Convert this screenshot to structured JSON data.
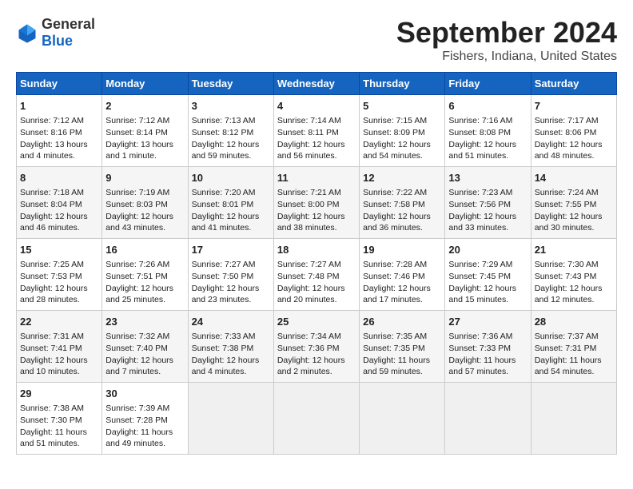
{
  "header": {
    "logo_general": "General",
    "logo_blue": "Blue",
    "month_year": "September 2024",
    "location": "Fishers, Indiana, United States"
  },
  "days_of_week": [
    "Sunday",
    "Monday",
    "Tuesday",
    "Wednesday",
    "Thursday",
    "Friday",
    "Saturday"
  ],
  "weeks": [
    [
      {
        "day": 1,
        "lines": [
          "Sunrise: 7:12 AM",
          "Sunset: 8:16 PM",
          "Daylight: 13 hours",
          "and 4 minutes."
        ]
      },
      {
        "day": 2,
        "lines": [
          "Sunrise: 7:12 AM",
          "Sunset: 8:14 PM",
          "Daylight: 13 hours",
          "and 1 minute."
        ]
      },
      {
        "day": 3,
        "lines": [
          "Sunrise: 7:13 AM",
          "Sunset: 8:12 PM",
          "Daylight: 12 hours",
          "and 59 minutes."
        ]
      },
      {
        "day": 4,
        "lines": [
          "Sunrise: 7:14 AM",
          "Sunset: 8:11 PM",
          "Daylight: 12 hours",
          "and 56 minutes."
        ]
      },
      {
        "day": 5,
        "lines": [
          "Sunrise: 7:15 AM",
          "Sunset: 8:09 PM",
          "Daylight: 12 hours",
          "and 54 minutes."
        ]
      },
      {
        "day": 6,
        "lines": [
          "Sunrise: 7:16 AM",
          "Sunset: 8:08 PM",
          "Daylight: 12 hours",
          "and 51 minutes."
        ]
      },
      {
        "day": 7,
        "lines": [
          "Sunrise: 7:17 AM",
          "Sunset: 8:06 PM",
          "Daylight: 12 hours",
          "and 48 minutes."
        ]
      }
    ],
    [
      {
        "day": 8,
        "lines": [
          "Sunrise: 7:18 AM",
          "Sunset: 8:04 PM",
          "Daylight: 12 hours",
          "and 46 minutes."
        ]
      },
      {
        "day": 9,
        "lines": [
          "Sunrise: 7:19 AM",
          "Sunset: 8:03 PM",
          "Daylight: 12 hours",
          "and 43 minutes."
        ]
      },
      {
        "day": 10,
        "lines": [
          "Sunrise: 7:20 AM",
          "Sunset: 8:01 PM",
          "Daylight: 12 hours",
          "and 41 minutes."
        ]
      },
      {
        "day": 11,
        "lines": [
          "Sunrise: 7:21 AM",
          "Sunset: 8:00 PM",
          "Daylight: 12 hours",
          "and 38 minutes."
        ]
      },
      {
        "day": 12,
        "lines": [
          "Sunrise: 7:22 AM",
          "Sunset: 7:58 PM",
          "Daylight: 12 hours",
          "and 36 minutes."
        ]
      },
      {
        "day": 13,
        "lines": [
          "Sunrise: 7:23 AM",
          "Sunset: 7:56 PM",
          "Daylight: 12 hours",
          "and 33 minutes."
        ]
      },
      {
        "day": 14,
        "lines": [
          "Sunrise: 7:24 AM",
          "Sunset: 7:55 PM",
          "Daylight: 12 hours",
          "and 30 minutes."
        ]
      }
    ],
    [
      {
        "day": 15,
        "lines": [
          "Sunrise: 7:25 AM",
          "Sunset: 7:53 PM",
          "Daylight: 12 hours",
          "and 28 minutes."
        ]
      },
      {
        "day": 16,
        "lines": [
          "Sunrise: 7:26 AM",
          "Sunset: 7:51 PM",
          "Daylight: 12 hours",
          "and 25 minutes."
        ]
      },
      {
        "day": 17,
        "lines": [
          "Sunrise: 7:27 AM",
          "Sunset: 7:50 PM",
          "Daylight: 12 hours",
          "and 23 minutes."
        ]
      },
      {
        "day": 18,
        "lines": [
          "Sunrise: 7:27 AM",
          "Sunset: 7:48 PM",
          "Daylight: 12 hours",
          "and 20 minutes."
        ]
      },
      {
        "day": 19,
        "lines": [
          "Sunrise: 7:28 AM",
          "Sunset: 7:46 PM",
          "Daylight: 12 hours",
          "and 17 minutes."
        ]
      },
      {
        "day": 20,
        "lines": [
          "Sunrise: 7:29 AM",
          "Sunset: 7:45 PM",
          "Daylight: 12 hours",
          "and 15 minutes."
        ]
      },
      {
        "day": 21,
        "lines": [
          "Sunrise: 7:30 AM",
          "Sunset: 7:43 PM",
          "Daylight: 12 hours",
          "and 12 minutes."
        ]
      }
    ],
    [
      {
        "day": 22,
        "lines": [
          "Sunrise: 7:31 AM",
          "Sunset: 7:41 PM",
          "Daylight: 12 hours",
          "and 10 minutes."
        ]
      },
      {
        "day": 23,
        "lines": [
          "Sunrise: 7:32 AM",
          "Sunset: 7:40 PM",
          "Daylight: 12 hours",
          "and 7 minutes."
        ]
      },
      {
        "day": 24,
        "lines": [
          "Sunrise: 7:33 AM",
          "Sunset: 7:38 PM",
          "Daylight: 12 hours",
          "and 4 minutes."
        ]
      },
      {
        "day": 25,
        "lines": [
          "Sunrise: 7:34 AM",
          "Sunset: 7:36 PM",
          "Daylight: 12 hours",
          "and 2 minutes."
        ]
      },
      {
        "day": 26,
        "lines": [
          "Sunrise: 7:35 AM",
          "Sunset: 7:35 PM",
          "Daylight: 11 hours",
          "and 59 minutes."
        ]
      },
      {
        "day": 27,
        "lines": [
          "Sunrise: 7:36 AM",
          "Sunset: 7:33 PM",
          "Daylight: 11 hours",
          "and 57 minutes."
        ]
      },
      {
        "day": 28,
        "lines": [
          "Sunrise: 7:37 AM",
          "Sunset: 7:31 PM",
          "Daylight: 11 hours",
          "and 54 minutes."
        ]
      }
    ],
    [
      {
        "day": 29,
        "lines": [
          "Sunrise: 7:38 AM",
          "Sunset: 7:30 PM",
          "Daylight: 11 hours",
          "and 51 minutes."
        ]
      },
      {
        "day": 30,
        "lines": [
          "Sunrise: 7:39 AM",
          "Sunset: 7:28 PM",
          "Daylight: 11 hours",
          "and 49 minutes."
        ]
      },
      null,
      null,
      null,
      null,
      null
    ]
  ]
}
